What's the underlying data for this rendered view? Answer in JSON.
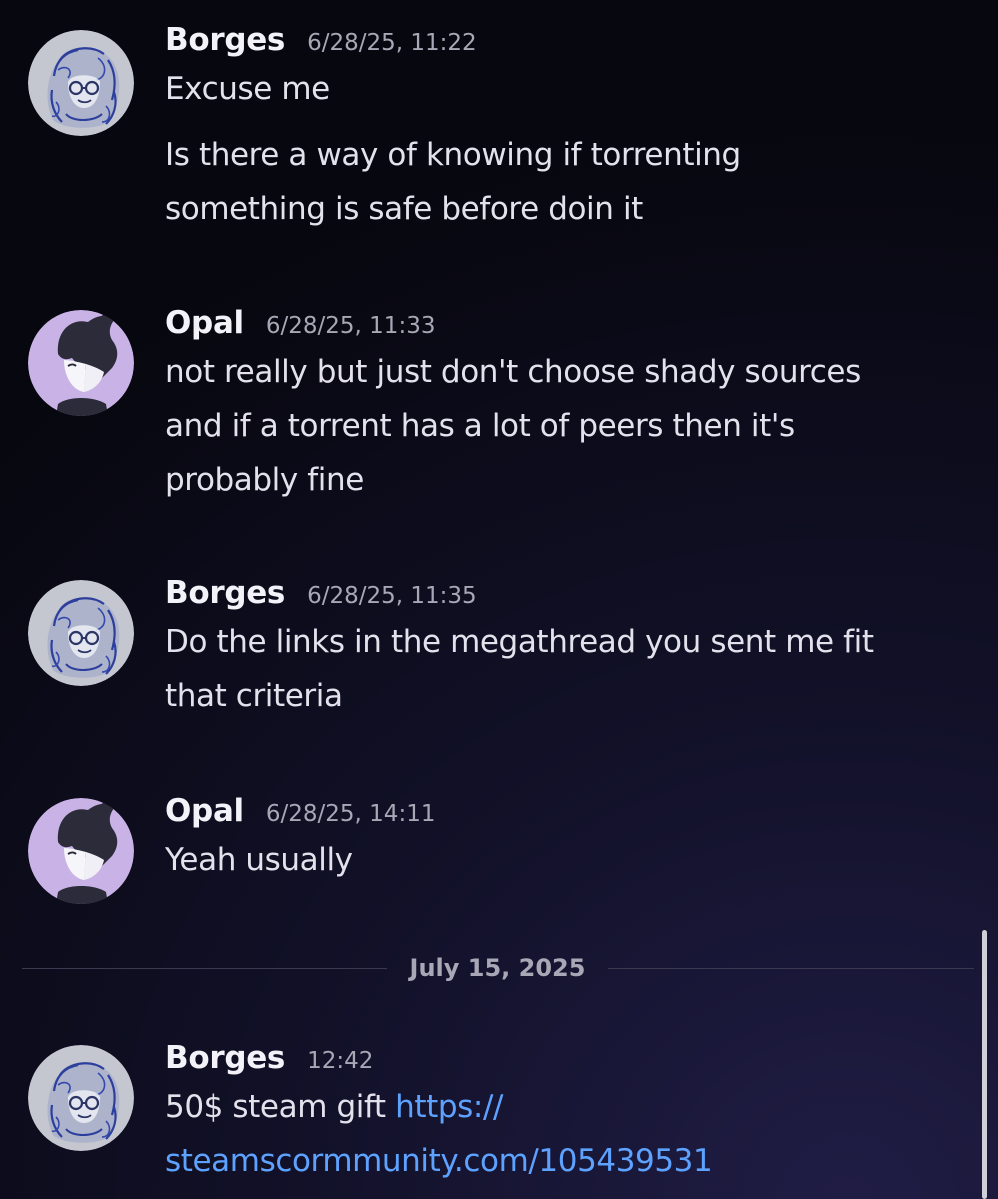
{
  "messages": [
    {
      "author": "Borges",
      "timestamp": "6/28/25, 11:22",
      "line1": "Excuse me",
      "line2": "Is there a way of knowing if torrenting",
      "line3": "something is safe before doin it"
    },
    {
      "author": "Opal",
      "timestamp": "6/28/25, 11:33",
      "line1": "not really but just don't choose shady sources",
      "line2": "and if a torrent has a lot of peers then it's",
      "line3": "probably fine"
    },
    {
      "author": "Borges",
      "timestamp": "6/28/25, 11:35",
      "line1": "Do the links in the megathread you sent me fit",
      "line2": "that criteria"
    },
    {
      "author": "Opal",
      "timestamp": "6/28/25, 14:11",
      "line1": "Yeah usually"
    },
    {
      "author": "Borges",
      "timestamp": "12:42",
      "text": "50$ steam gift ",
      "link_part1": "https://",
      "link_part2": "steamscormmunity.com/105439531"
    }
  ],
  "date_divider": "July 15, 2025",
  "colors": {
    "link": "#5ea2ff",
    "background": "#0b0a18",
    "opal_avatar": "#c9b3e6",
    "borges_avatar": "#c4c7d2"
  },
  "icons": {
    "borges_avatar": "sketch-portrait-glasses",
    "opal_avatar": "cat-ear-character"
  }
}
